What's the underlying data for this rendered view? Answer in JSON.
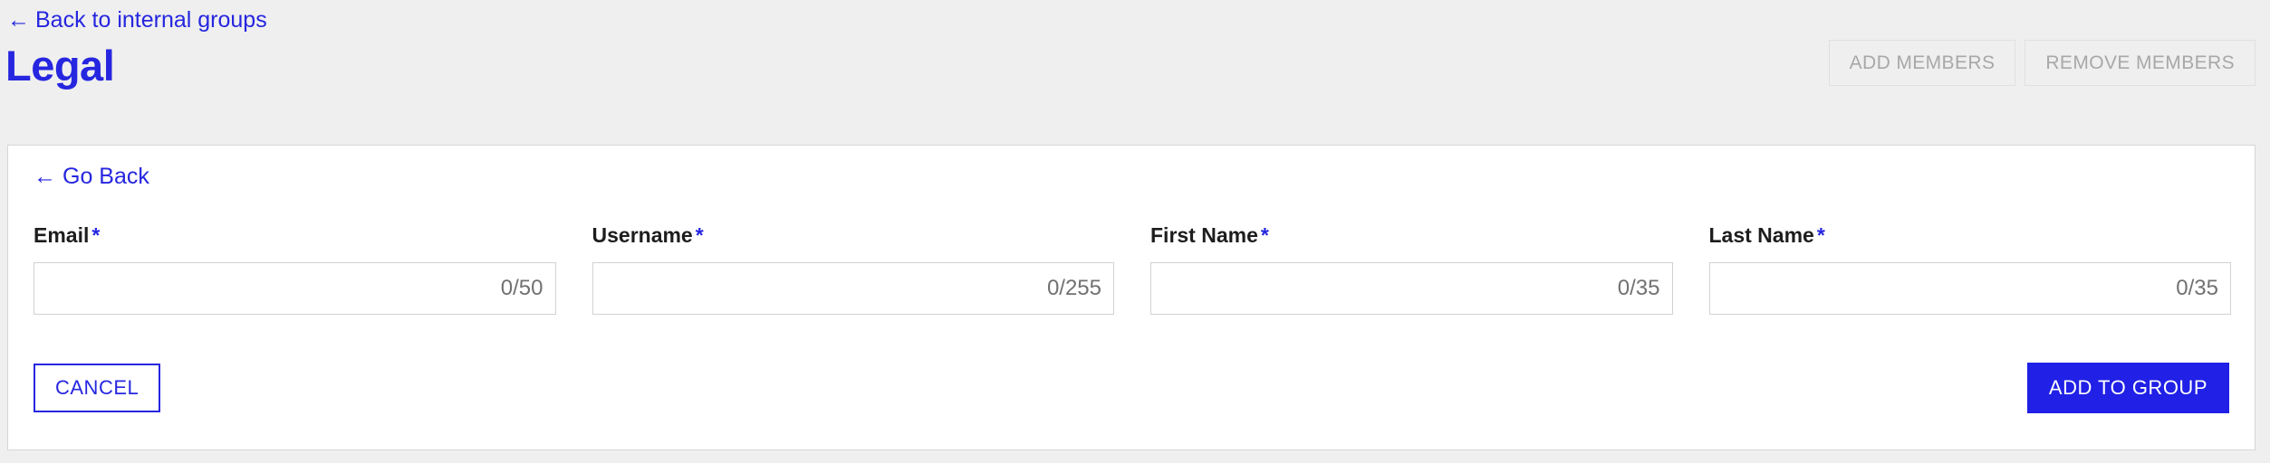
{
  "colors": {
    "brand_blue": "#2626e0",
    "primary_button_bg": "#2020e6",
    "page_background": "#efefef",
    "card_background": "#ffffff",
    "disabled_text": "#a8a8a8",
    "counter_text": "#717171"
  },
  "header": {
    "back_link": {
      "arrow": "←",
      "label": "Back to internal groups"
    },
    "title": "Legal",
    "actions": [
      {
        "label": "ADD MEMBERS",
        "disabled": true
      },
      {
        "label": "REMOVE MEMBERS",
        "disabled": true
      }
    ]
  },
  "card": {
    "go_back": {
      "arrow": "←",
      "label": "Go Back"
    },
    "fields": [
      {
        "label": "Email",
        "required_marker": "*",
        "value": "",
        "placeholder": "",
        "counter": "0/50",
        "max_length": 50
      },
      {
        "label": "Username",
        "required_marker": "*",
        "value": "",
        "placeholder": "",
        "counter": "0/255",
        "max_length": 255
      },
      {
        "label": "First Name",
        "required_marker": "*",
        "value": "",
        "placeholder": "",
        "counter": "0/35",
        "max_length": 35
      },
      {
        "label": "Last Name",
        "required_marker": "*",
        "value": "",
        "placeholder": "",
        "counter": "0/35",
        "max_length": 35
      }
    ],
    "cancel_label": "CANCEL",
    "submit_label": "ADD TO GROUP"
  }
}
